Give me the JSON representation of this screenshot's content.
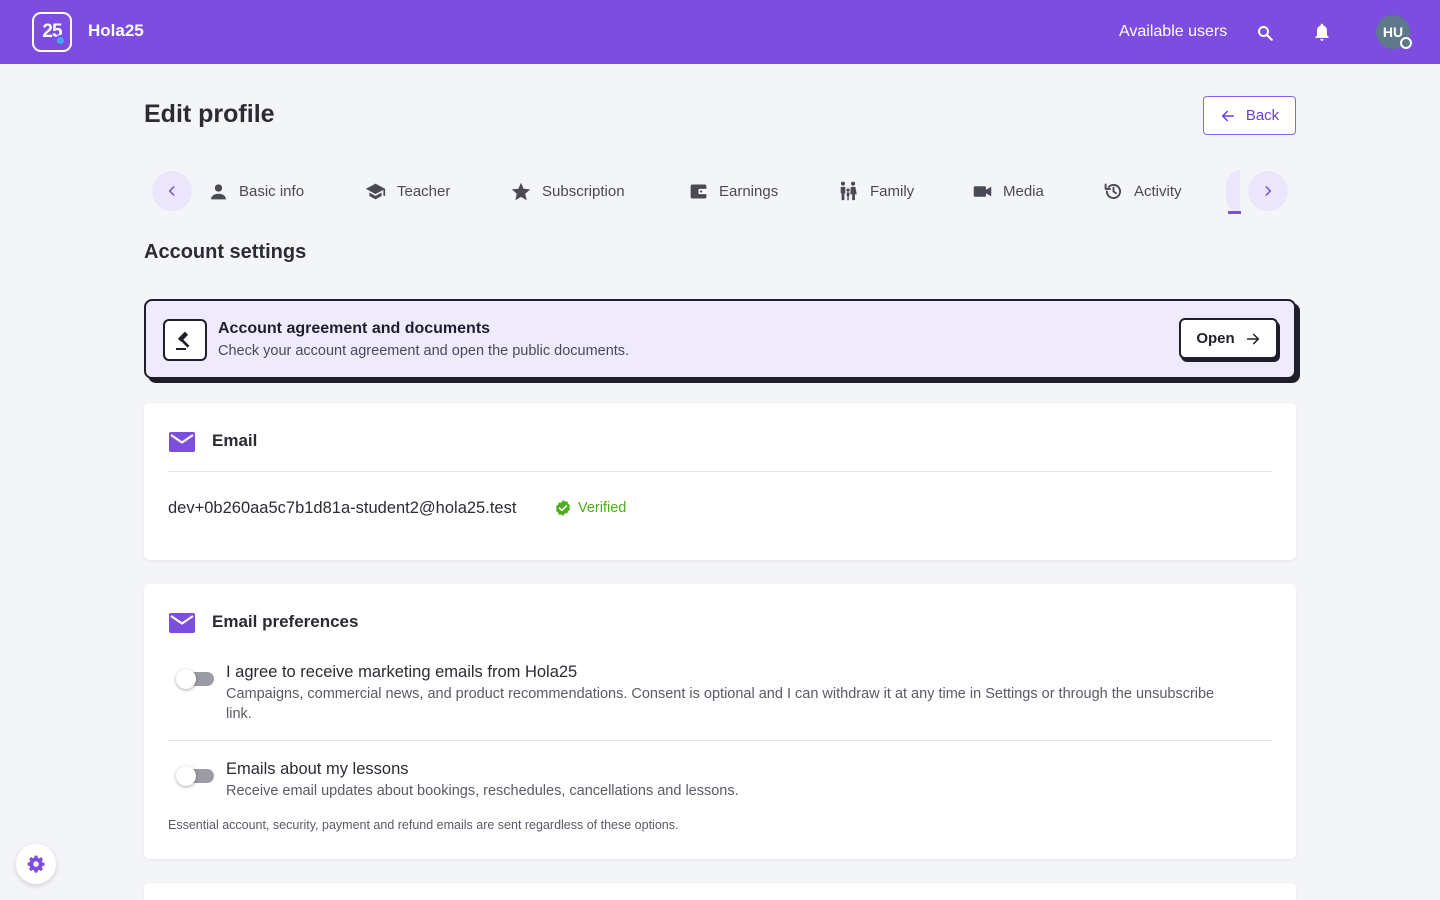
{
  "app": {
    "logo_text": "25",
    "brand": "Hola25"
  },
  "topbar": {
    "available_users": "Available users",
    "avatar_initials": "HU",
    "icons": [
      "search-icon",
      "bell-icon"
    ]
  },
  "page": {
    "title": "Edit profile",
    "back_label": "Back"
  },
  "tabs": [
    {
      "label": "Basic info",
      "icon": "person-icon"
    },
    {
      "label": "Teacher",
      "icon": "graduation-cap-icon"
    },
    {
      "label": "Subscription",
      "icon": "star-icon"
    },
    {
      "label": "Earnings",
      "icon": "wallet-icon"
    },
    {
      "label": "Family",
      "icon": "family-icon"
    },
    {
      "label": "Media",
      "icon": "video-camera-icon"
    },
    {
      "label": "Activity",
      "icon": "history-icon"
    }
  ],
  "section": {
    "title": "Account settings"
  },
  "agreement": {
    "title": "Account agreement and documents",
    "subtitle": "Check your account agreement and open the public documents.",
    "open_label": "Open"
  },
  "email_card": {
    "title": "Email",
    "email": "dev+0b260aa5c7b1d81a-student2@hola25.test",
    "status": "Verified"
  },
  "prefs_card": {
    "title": "Email preferences",
    "items": [
      {
        "title": "I agree to receive marketing emails from Hola25",
        "description": "Campaigns, commercial news, and product recommendations. Consent is optional and I can withdraw it at any time in Settings or through the unsubscribe link.",
        "enabled": false
      },
      {
        "title": "Emails about my lessons",
        "description": "Receive email updates about bookings, reschedules, cancellations and lessons.",
        "enabled": false
      }
    ],
    "footnote": "Essential account, security, payment and refund emails are sent regardless of these options."
  },
  "colors": {
    "brand": "#7c4ddf",
    "verified": "#4caf1a",
    "background": "#f4f5f9"
  }
}
